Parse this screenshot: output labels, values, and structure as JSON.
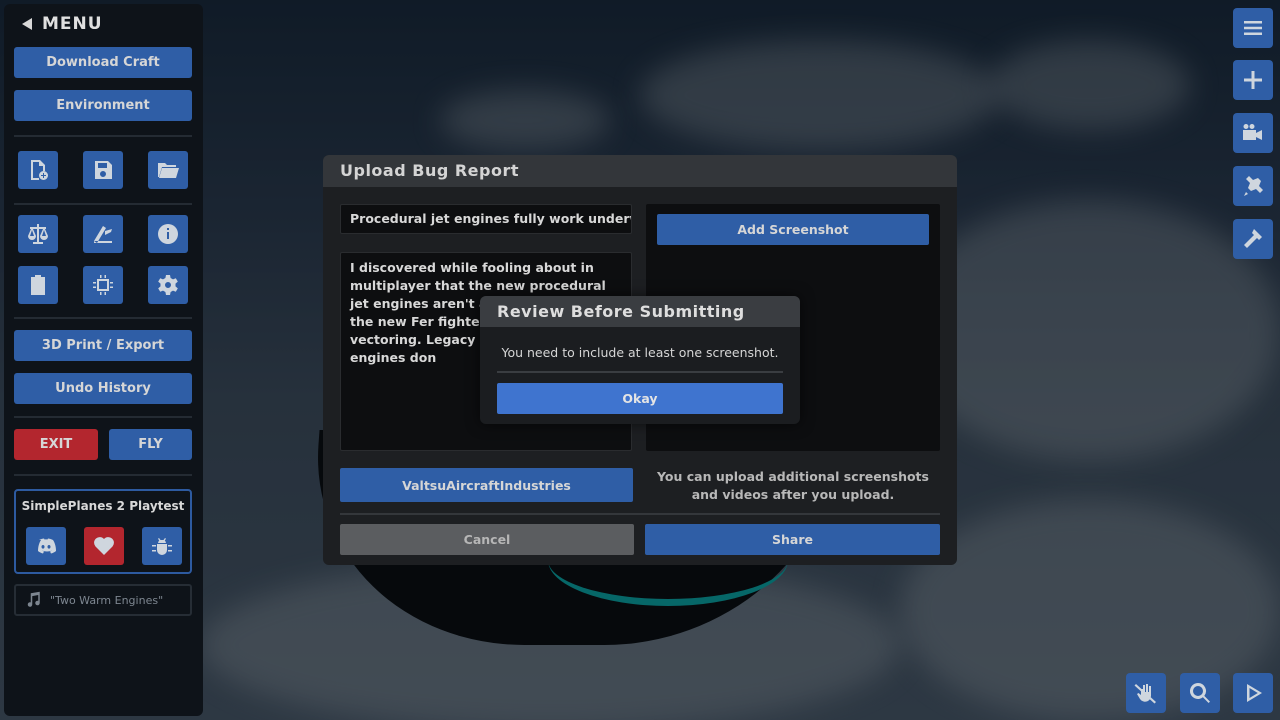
{
  "menu": {
    "title": "MENU",
    "download_craft": "Download Craft",
    "environment": "Environment",
    "print_export": "3D Print / Export",
    "undo_history": "Undo History",
    "exit": "EXIT",
    "fly": "FLY",
    "exit_color": "#b3262e",
    "accent_color": "#2f5ea6",
    "playtest_title": "SimplePlanes 2 Playtest",
    "music_track": "\"Two Warm Engines\""
  },
  "upload_dialog": {
    "title": "Upload Bug Report",
    "report_title": "Procedural jet engines fully work underwater",
    "report_description": "I discovered while fooling about in multiplayer that the new procedural jet engines aren't affecte even \"fly\" the new Fer fighters underwater th vectoring. Legacy eng propeller engines don",
    "add_screenshot": "Add Screenshot",
    "author": "ValtsuAircraftIndustries",
    "upload_note": "You can upload additional screenshots and videos after you upload.",
    "cancel": "Cancel",
    "share": "Share"
  },
  "review_modal": {
    "title": "Review Before Submitting",
    "message": "You need to include at least one screenshot.",
    "okay": "Okay"
  }
}
